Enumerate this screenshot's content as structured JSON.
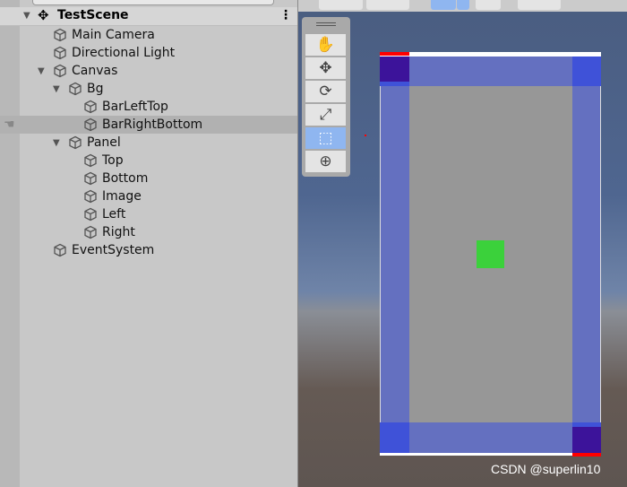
{
  "hierarchy": {
    "scene": "TestScene",
    "items": [
      {
        "label": "Main Camera",
        "depth": 0,
        "expanded": null
      },
      {
        "label": "Directional Light",
        "depth": 0,
        "expanded": null
      },
      {
        "label": "Canvas",
        "depth": 0,
        "expanded": true
      },
      {
        "label": "Bg",
        "depth": 1,
        "expanded": true
      },
      {
        "label": "BarLeftTop",
        "depth": 2,
        "expanded": null
      },
      {
        "label": "BarRightBottom",
        "depth": 2,
        "expanded": null,
        "selected": true
      },
      {
        "label": "Panel",
        "depth": 1,
        "expanded": true
      },
      {
        "label": "Top",
        "depth": 2,
        "expanded": null
      },
      {
        "label": "Bottom",
        "depth": 2,
        "expanded": null
      },
      {
        "label": "Image",
        "depth": 2,
        "expanded": null
      },
      {
        "label": "Left",
        "depth": 2,
        "expanded": null
      },
      {
        "label": "Right",
        "depth": 2,
        "expanded": null
      },
      {
        "label": "EventSystem",
        "depth": 0,
        "expanded": null
      }
    ]
  },
  "scene": {
    "tools": [
      "hand-icon",
      "move-icon",
      "rotate-icon",
      "scale-icon",
      "rect-tool-icon",
      "transform-icon"
    ],
    "active_tool": "rect-tool-icon",
    "colors": {
      "panel_overlay": "#6470c0",
      "panel_inner": "#979797",
      "corner_dark": "#3c139a",
      "corner_blue": "#3f52d8",
      "marker_red": "#ff0000",
      "green_image": "#3bd13b"
    }
  },
  "watermark": "CSDN @superlin10"
}
